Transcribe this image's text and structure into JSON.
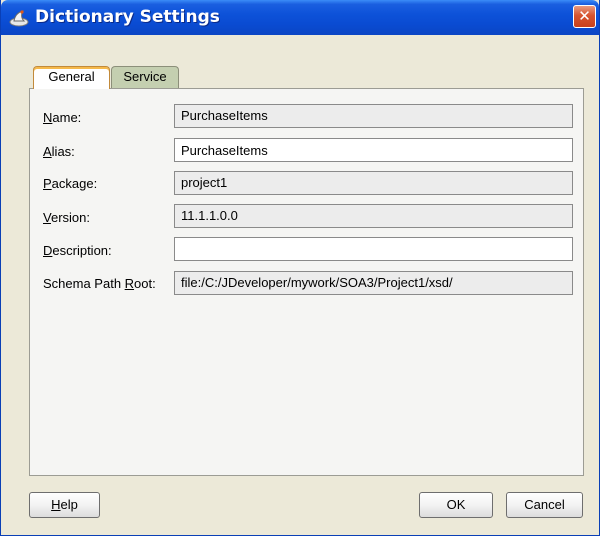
{
  "window": {
    "title": "Dictionary Settings",
    "close_glyph": "✕",
    "icon": "dictionary-icon"
  },
  "tabs": [
    {
      "label": "General",
      "selected": true
    },
    {
      "label": "Service",
      "selected": false
    }
  ],
  "form": {
    "name": {
      "mnemonic": "N",
      "rest": "ame:",
      "value": "PurchaseItems",
      "editable": false
    },
    "alias": {
      "mnemonic": "A",
      "rest": "lias:",
      "value": "PurchaseItems",
      "editable": true
    },
    "package": {
      "mnemonic": "P",
      "rest": "ackage:",
      "value": "project1",
      "editable": false
    },
    "version": {
      "mnemonic": "V",
      "rest": "ersion:",
      "value": "11.1.1.0.0",
      "editable": false
    },
    "description": {
      "mnemonic": "D",
      "rest": "escription:",
      "value": "",
      "editable": true
    },
    "schema_path_root": {
      "before": "Schema Path ",
      "mnemonic": "R",
      "rest": "oot:",
      "value": "file:/C:/JDeveloper/mywork/SOA3/Project1/xsd/",
      "editable": false
    }
  },
  "buttons": {
    "help": {
      "mnemonic": "H",
      "rest": "elp"
    },
    "ok": "OK",
    "cancel": "Cancel"
  },
  "colors": {
    "titlebar": "#0a4bd2",
    "close": "#d7542f",
    "dialog_bg": "#ece9d8",
    "selected_tab_accent": "#f5b94a"
  }
}
